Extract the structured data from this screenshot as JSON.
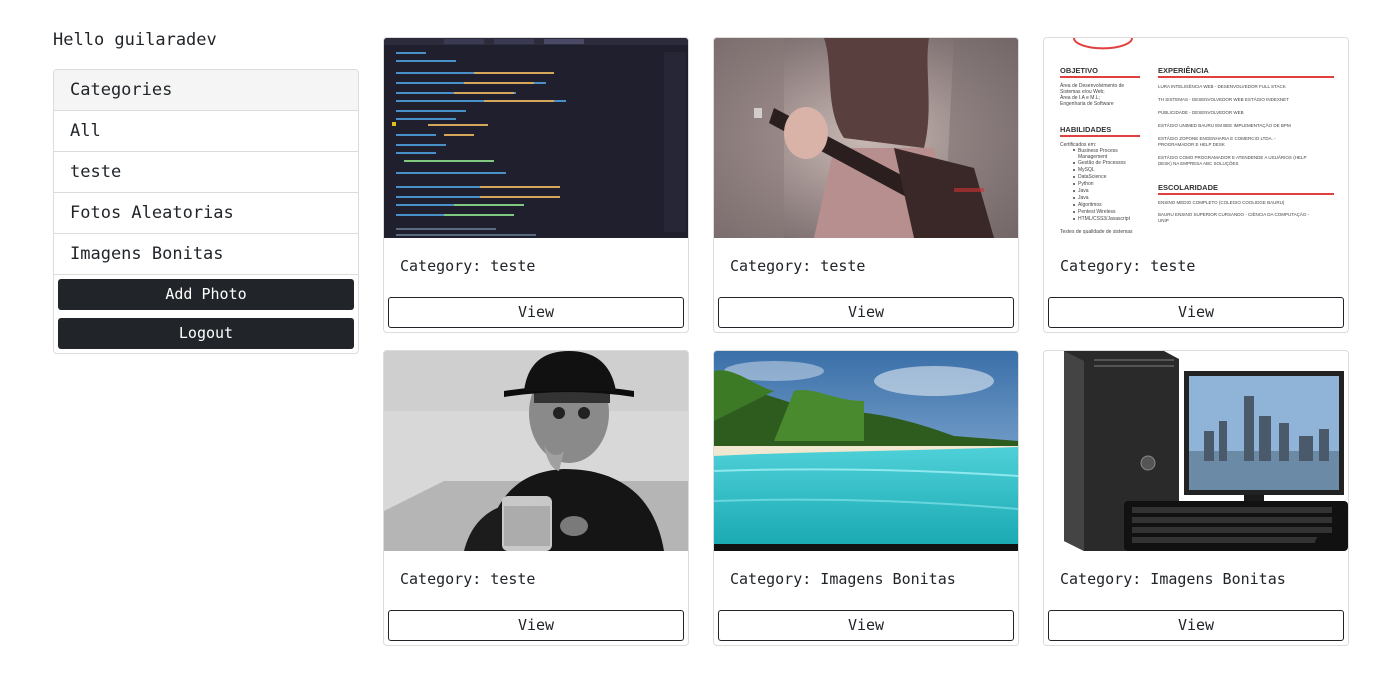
{
  "greeting": "Hello guilaradev",
  "sidebar": {
    "header": "Categories",
    "items": [
      {
        "label": "All"
      },
      {
        "label": "teste"
      },
      {
        "label": "Fotos Aleatorias"
      },
      {
        "label": "Imagens Bonitas"
      }
    ],
    "add_photo_label": "Add Photo",
    "logout_label": "Logout"
  },
  "photos": [
    {
      "category_text": "Category: teste",
      "view_label": "View",
      "image": "code-editor-screenshot"
    },
    {
      "category_text": "Category: teste",
      "view_label": "View",
      "image": "guitar-player-photo"
    },
    {
      "category_text": "Category: teste",
      "view_label": "View",
      "image": "resume-document"
    },
    {
      "category_text": "Category: teste",
      "view_label": "View",
      "image": "man-with-hat-photo"
    },
    {
      "category_text": "Category: Imagens Bonitas",
      "view_label": "View",
      "image": "beach-photo"
    },
    {
      "category_text": "Category: Imagens Bonitas",
      "view_label": "View",
      "image": "computer-set-photo"
    }
  ],
  "resume": {
    "objetivo": "OBJETIVO",
    "objetivo_text": [
      "Área de Desenvolvimento de",
      "Sistemas e/ou Web;",
      "Área de I.A e M.L;",
      "Engenharia de Software"
    ],
    "habilidades": "HABILIDADES",
    "certificados": "Certificados em:",
    "skills": [
      "Business Process",
      "Management",
      "Gestão de Processos",
      "MySQL",
      "DataScience",
      "Python",
      "Java",
      "Java",
      "Algoritmos",
      "Pentest Wireless",
      "HTML/CSS3/Javascript"
    ],
    "testes": "Testes de qualidade de sistemas",
    "experiencia": "EXPERIÊNCIA",
    "exp_items": [
      "LURA INTELIGÊNCIA WEB - DESENVOLVEDOR FULL STACK",
      "TH SISTEMAS - DESENVOLVEDOR WEB ESTÁGIO INDEXNET",
      "PUBLICIDADE - DESENVOLVEDOR WEB",
      "ESTÁGIO UNIMED BAURU EM BEE IMPLEMENTAÇÃO DE BPM",
      "ESTÁGIO ZOPONE ENGENHARIA E COMERCIO LTDA. -",
      "PROGRAMADOR E HELP DESK",
      "ESTÁGIO COMO PROGRAMADOR E ATENDENDE A USUÁRIOS (HELP",
      "DESK) NA EMPRESA ABC SOLUÇÕES"
    ],
    "escolaridade": "ESCOLARIDADE",
    "edu_items": [
      "ENSINO MEDIO COMPLETO (COLEGIO COOLIDGE BAURU)",
      "BAURU ENSINO SUPERIOR CURSANDO - CIÊNCIA DA COMPUTAÇÃO -",
      "UNIP"
    ]
  },
  "colors": {
    "dark_button": "#212529",
    "border": "#dcdcdc",
    "resume_accent": "#e0403f"
  }
}
